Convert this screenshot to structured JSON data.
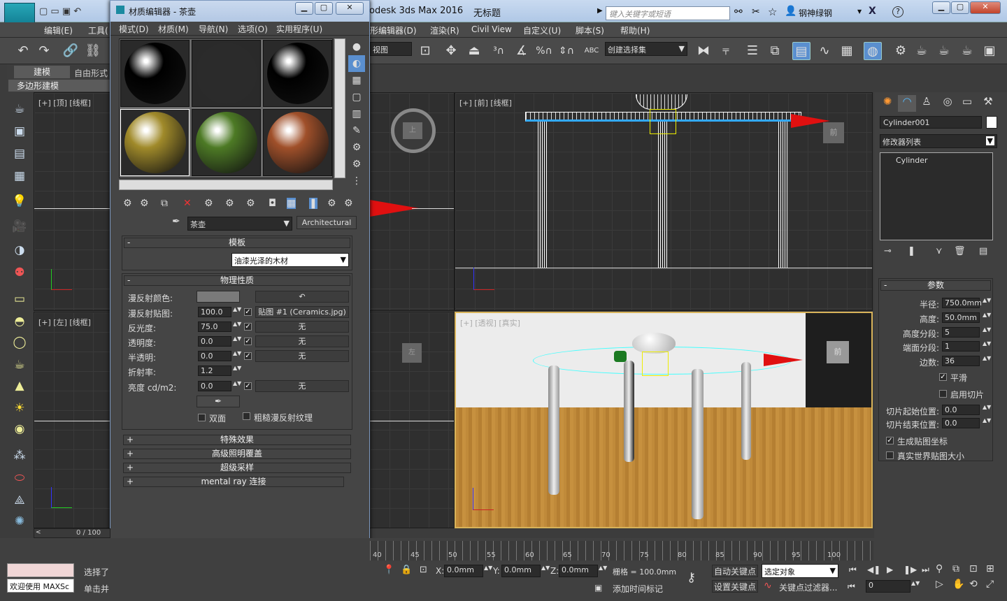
{
  "app": {
    "title_prefix": "odesk 3ds Max 2016",
    "doc_title": "无标题",
    "search_placeholder": "键入关键字或短语",
    "user": "钢神绿钢",
    "logo": "MAX"
  },
  "menubar": {
    "left": [
      "编辑(E)",
      "工具("
    ],
    "right": [
      "形编辑器(D)",
      "渲染(R)",
      "Civil View",
      "自定义(U)",
      "脚本(S)",
      "帮助(H)"
    ]
  },
  "toolbar": {
    "view_combo": "视图",
    "selset_combo": "创建选择集",
    "abc_label": "ABC"
  },
  "ribbon": {
    "tab_modeling": "建模",
    "tab_freeform": "自由形式",
    "sub": "多边形建模"
  },
  "viewports": {
    "top": "[+] [顶] [线框]",
    "front": "[+] [前] [线框]",
    "left": "[+] [左] [线框]",
    "persp": "[+] [透视] [真实]",
    "cube_front": "前",
    "cube_left": "左",
    "cube_top": "上"
  },
  "material_editor": {
    "title": "材质编辑器 - 茶壶",
    "menus": [
      "模式(D)",
      "材质(M)",
      "导航(N)",
      "选项(O)",
      "实用程序(U)"
    ],
    "material_name": "茶壶",
    "material_type": "Architectural",
    "rollout_template": "模板",
    "template_value": "油漆光泽的木材",
    "rollout_physical": "物理性质",
    "fields": [
      {
        "label": "漫反射颜色:",
        "value": "",
        "map": ""
      },
      {
        "label": "漫反射贴图:",
        "value": "100.0",
        "map": "贴图 #1 (Ceramics.jpg)"
      },
      {
        "label": "反光度:",
        "value": "75.0",
        "map": "无"
      },
      {
        "label": "透明度:",
        "value": "0.0",
        "map": "无"
      },
      {
        "label": "半透明:",
        "value": "0.0",
        "map": "无"
      },
      {
        "label": "折射率:",
        "value": "1.2",
        "map": ""
      },
      {
        "label": "亮度 cd/m2:",
        "value": "0.0",
        "map": "无"
      }
    ],
    "two_sided": "双面",
    "rough_diffuse": "粗糙漫反射纹理",
    "rollouts": [
      "特殊效果",
      "高级照明覆盖",
      "超级采样",
      "mental ray 连接"
    ],
    "sphere_colors": [
      "#000000",
      "#2b2b2b",
      "#000000",
      "#a08a2a",
      "#4d7a25",
      "#a0502a"
    ]
  },
  "command_panel": {
    "object_name": "Cylinder001",
    "modifier_list": "修改器列表",
    "stack_item": "Cylinder",
    "params_title": "参数",
    "params": [
      {
        "label": "半径:",
        "value": "750.0mm"
      },
      {
        "label": "高度:",
        "value": "50.0mm"
      },
      {
        "label": "高度分段:",
        "value": "5"
      },
      {
        "label": "端面分段:",
        "value": "1"
      },
      {
        "label": "边数:",
        "value": "36"
      }
    ],
    "smooth": "平滑",
    "slice_on": "启用切片",
    "slice_from": "切片起始位置:",
    "slice_to": "切片结束位置:",
    "slice_from_val": "0.0",
    "slice_to_val": "0.0",
    "gen_map": "生成贴图坐标",
    "real_world": "真实世界贴图大小"
  },
  "bottom": {
    "frame": "0 / 100",
    "ticks": [
      "40",
      "45",
      "50",
      "55",
      "60",
      "65",
      "70",
      "75",
      "80",
      "85",
      "90",
      "95",
      "100"
    ],
    "welcome": "欢迎使用 MAXSc",
    "select_text": "选择了",
    "click_text": "单击并",
    "x": "0.0mm",
    "y": "0.0mm",
    "z": "0.0mm",
    "grid": "栅格 = 100.0mm",
    "add_tag": "添加时间标记",
    "auto_key": "自动关键点",
    "set_key": "设置关键点",
    "sel_obj": "选定对象",
    "key_filter": "关键点过滤器...",
    "frame_field": "0",
    "x_label": "X:",
    "y_label": "Y:",
    "z_label": "Z:"
  }
}
